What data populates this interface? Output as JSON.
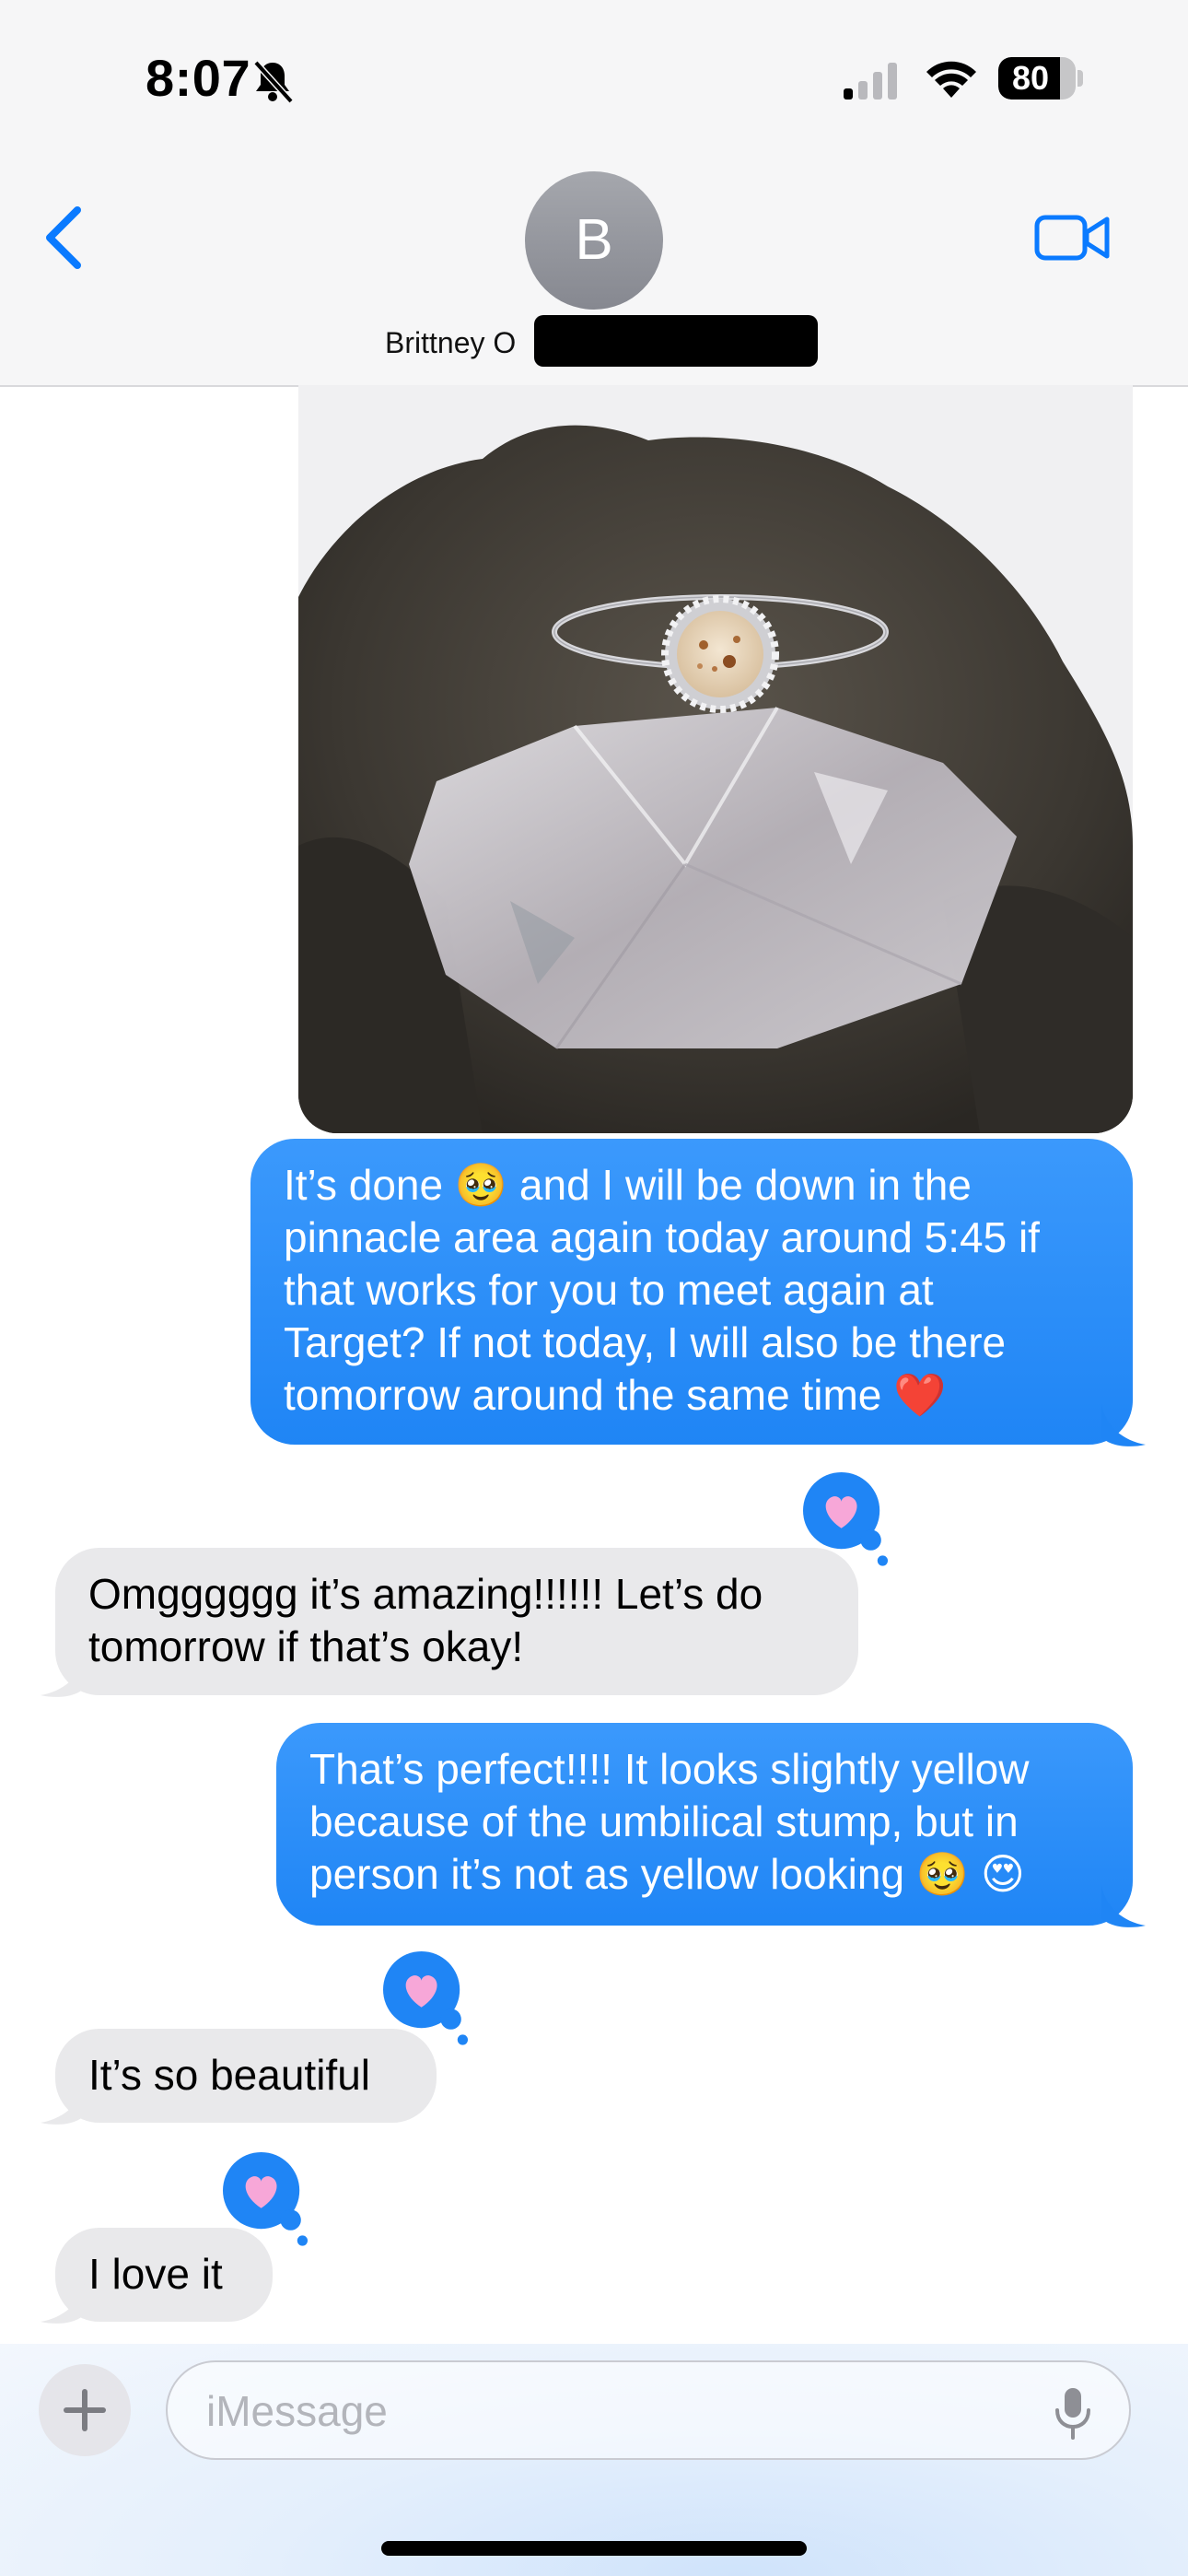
{
  "status_bar": {
    "time": "8:07",
    "battery": "80",
    "battery_level": 0.8,
    "icons": [
      "bell-slash-icon",
      "cellular-signal-icon",
      "wifi-icon",
      "battery-icon"
    ]
  },
  "header": {
    "back_icon": "chevron-left-icon",
    "avatar_initial": "B",
    "contact_name": "Brittney O",
    "video_icon": "video-camera-icon"
  },
  "messages": [
    {
      "type": "photo",
      "direction": "sent",
      "description_icon": "ring-photo"
    },
    {
      "direction": "sent",
      "lines": [
        "It’s done 🥹 and I will be down in the",
        "pinnacle area again today around 5:45 if",
        "that works for you to meet again at",
        "Target? If not today, I will also be there",
        "tomorrow around the same time ❤️"
      ]
    },
    {
      "direction": "received",
      "tapback": "heart",
      "lines": [
        "Omgggggg it’s amazing!!!!!! Let’s do",
        "tomorrow if that’s okay!"
      ]
    },
    {
      "direction": "sent",
      "lines": [
        "That’s perfect!!!! It looks slightly yellow",
        "because of the umbilical stump, but in",
        "person it’s not as yellow looking 🥹 😍"
      ]
    },
    {
      "direction": "received",
      "tapback": "heart",
      "lines": [
        "It’s so beautiful"
      ]
    },
    {
      "direction": "received",
      "tapback": "heart",
      "lines": [
        "I love it"
      ]
    }
  ],
  "composer": {
    "placeholder": "iMessage",
    "plus_icon": "plus-icon",
    "mic_icon": "microphone-icon"
  },
  "colors": {
    "sent_bubble": "#1f85f5",
    "received_bubble": "#e9e9eb",
    "accent": "#0a7aff",
    "heart": "#f7a7d8"
  }
}
